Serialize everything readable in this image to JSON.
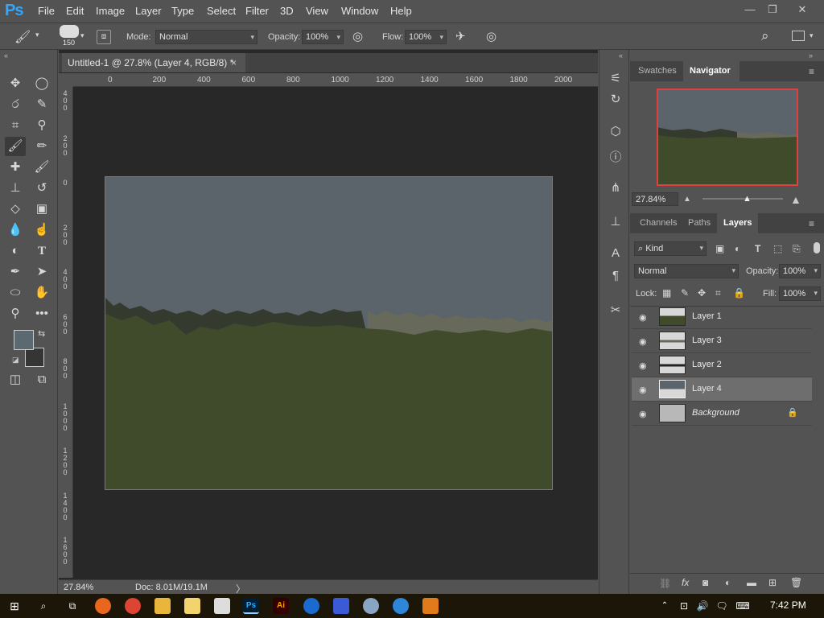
{
  "app": {
    "logo": "Ps",
    "menus": [
      "File",
      "Edit",
      "Image",
      "Layer",
      "Type",
      "Select",
      "Filter",
      "3D",
      "View",
      "Window",
      "Help"
    ]
  },
  "window_controls": {
    "minimize": "—",
    "restore": "❐",
    "close": "✕"
  },
  "options_bar": {
    "brush_size": "150",
    "mode_label": "Mode:",
    "mode_value": "Normal",
    "opacity_label": "Opacity:",
    "opacity_value": "100%",
    "flow_label": "Flow:",
    "flow_value": "100%"
  },
  "document": {
    "tab_title": "Untitled-1 @ 27.8% (Layer 4, RGB/8) *",
    "close_glyph": "×",
    "zoom": "27.84%",
    "doc_size": "Doc: 8.01M/19.1M",
    "hruler_labels": [
      "0",
      "200",
      "400",
      "600",
      "800",
      "1000",
      "1200",
      "1400",
      "1600",
      "1800",
      "2000"
    ],
    "vruler_labels": [
      "400",
      "200",
      "0",
      "200",
      "400",
      "600",
      "800",
      "1000",
      "1200",
      "1400",
      "1600"
    ]
  },
  "colors": {
    "foreground": "#5b6a70",
    "background": "#353535",
    "sky": "#5b646a",
    "grass": "#3f4b2b",
    "treeline_dark": "#353a2e",
    "treeline_light": "#67695a",
    "ps_blue": "#31a8ff"
  },
  "navigator": {
    "tabs": [
      "Swatches",
      "Navigator"
    ],
    "active_tab": "Navigator",
    "zoom": "27.84%",
    "zoom_fraction": 0.55
  },
  "layers_panel": {
    "tabs": [
      "Channels",
      "Paths",
      "Layers"
    ],
    "active_tab": "Layers",
    "filter_kind": "Kind",
    "blend_mode": "Normal",
    "opacity_label": "Opacity:",
    "opacity_value": "100%",
    "lock_label": "Lock:",
    "fill_label": "Fill:",
    "fill_value": "100%",
    "layers": [
      {
        "name": "Layer 1",
        "selected": false
      },
      {
        "name": "Layer 3",
        "selected": false
      },
      {
        "name": "Layer 2",
        "selected": false
      },
      {
        "name": "Layer 4",
        "selected": true
      },
      {
        "name": "Background",
        "selected": false,
        "locked": true
      }
    ]
  },
  "taskbar": {
    "time": "7:42 PM"
  }
}
